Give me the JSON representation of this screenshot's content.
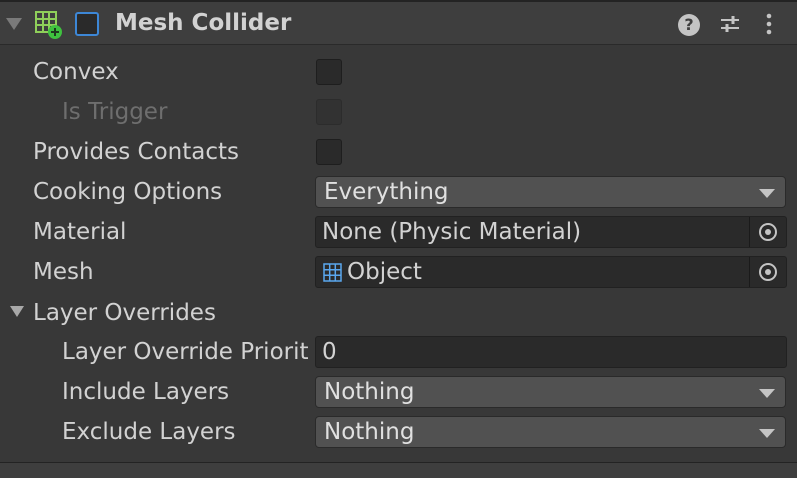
{
  "component": {
    "title": "Mesh Collider",
    "enabled": false,
    "icon": "mesh-collider-icon",
    "header_icons": [
      "help-icon",
      "presets-icon",
      "more-menu-icon"
    ]
  },
  "properties": {
    "convex": {
      "label": "Convex",
      "checked": false
    },
    "is_trigger": {
      "label": "Is Trigger",
      "checked": false,
      "disabled": true
    },
    "provides_contacts": {
      "label": "Provides Contacts",
      "checked": false
    },
    "cooking_options": {
      "label": "Cooking Options",
      "value": "Everything"
    },
    "material": {
      "label": "Material",
      "value": "None (Physic Material)"
    },
    "mesh": {
      "label": "Mesh",
      "value": "Object",
      "icon": "mesh-grid-icon"
    }
  },
  "layer_overrides": {
    "label": "Layer Overrides",
    "expanded": true,
    "priority": {
      "label": "Layer Override Priorit",
      "value": "0"
    },
    "include_layers": {
      "label": "Include Layers",
      "value": "Nothing"
    },
    "exclude_layers": {
      "label": "Exclude Layers",
      "value": "Nothing"
    }
  },
  "colors": {
    "background": "#383838",
    "header": "#3e3e3e",
    "enable_toggle": "#3d87d6",
    "icon_green": "#3fc23f",
    "icon_blue": "#5aa7ee"
  }
}
